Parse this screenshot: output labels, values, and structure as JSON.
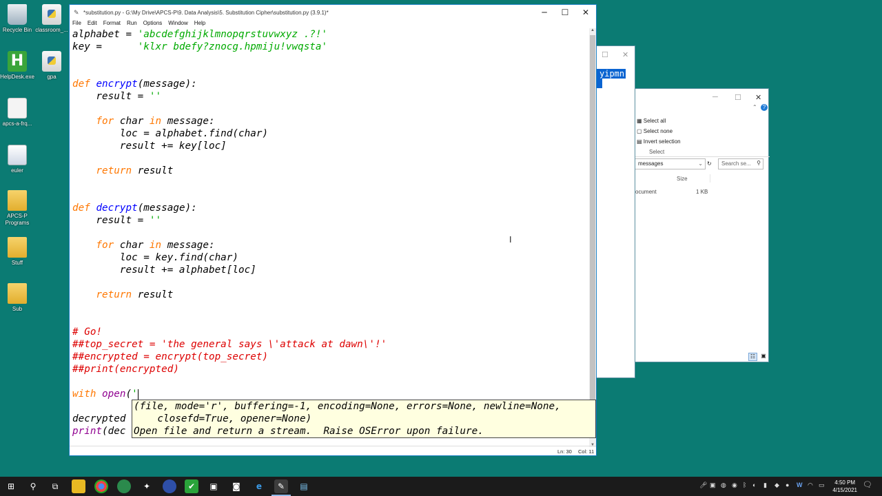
{
  "desktop": {
    "icons": [
      {
        "label": "Recycle Bin",
        "icon": "recycle-bin-icon"
      },
      {
        "label": "classroom_...",
        "icon": "python-file-icon"
      },
      {
        "label": "HelpDesk.exe",
        "icon": "helpdesk-icon"
      },
      {
        "label": "gpa",
        "icon": "python-file-icon"
      },
      {
        "label": "apcs-a-frq...",
        "icon": "document-icon"
      },
      {
        "label": "euler",
        "icon": "program-icon"
      },
      {
        "label": "APCS-P\nPrograms",
        "icon": "folder-icon"
      },
      {
        "label": "Stuff",
        "icon": "folder-icon"
      },
      {
        "label": "Sub",
        "icon": "folder-icon"
      }
    ]
  },
  "explorer_back": {
    "selected_text": "yipmn",
    "ribbon_items": [
      "Select all",
      "Select none",
      "Invert selection"
    ],
    "ribbon_group": "Select",
    "path_text": "messages",
    "search_placeholder": "Search se...",
    "column_size": "Size",
    "file_type": "ocument",
    "file_size": "1 KB"
  },
  "idle": {
    "title": "*substitution.py - G:\\My Drive\\APCS-P\\9. Data Analysis\\5. Substitution Cipher\\substitution.py (3.9.1)*",
    "menu": [
      "File",
      "Edit",
      "Format",
      "Run",
      "Options",
      "Window",
      "Help"
    ],
    "controls": {
      "minimize": "─",
      "maximize": "☐",
      "close": "✕"
    },
    "code": [
      [
        {
          "c": "txt",
          "t": "alphabet = "
        },
        {
          "c": "str",
          "t": "'abcdefghijklmnopqrstuvwxyz .?!'"
        }
      ],
      [
        {
          "c": "txt",
          "t": "key =      "
        },
        {
          "c": "str",
          "t": "'klxr bdefy?znocg.hpmiju!vwqsta'"
        }
      ],
      [],
      [],
      [
        {
          "c": "kw",
          "t": "def "
        },
        {
          "c": "def",
          "t": "encrypt"
        },
        {
          "c": "txt",
          "t": "(message):"
        }
      ],
      [
        {
          "c": "txt",
          "t": "    result = "
        },
        {
          "c": "str",
          "t": "''"
        }
      ],
      [],
      [
        {
          "c": "kw",
          "t": "    for "
        },
        {
          "c": "txt",
          "t": "char "
        },
        {
          "c": "kw",
          "t": "in "
        },
        {
          "c": "txt",
          "t": "message:"
        }
      ],
      [
        {
          "c": "txt",
          "t": "        loc = alphabet.find(char)"
        }
      ],
      [
        {
          "c": "txt",
          "t": "        result += key[loc]"
        }
      ],
      [],
      [
        {
          "c": "kw",
          "t": "    return "
        },
        {
          "c": "txt",
          "t": "result"
        }
      ],
      [],
      [],
      [
        {
          "c": "kw",
          "t": "def "
        },
        {
          "c": "def",
          "t": "decrypt"
        },
        {
          "c": "txt",
          "t": "(message):"
        }
      ],
      [
        {
          "c": "txt",
          "t": "    result = "
        },
        {
          "c": "str",
          "t": "''"
        }
      ],
      [],
      [
        {
          "c": "kw",
          "t": "    for "
        },
        {
          "c": "txt",
          "t": "char "
        },
        {
          "c": "kw",
          "t": "in "
        },
        {
          "c": "txt",
          "t": "message:"
        }
      ],
      [
        {
          "c": "txt",
          "t": "        loc = key.find(char)"
        }
      ],
      [
        {
          "c": "txt",
          "t": "        result += alphabet[loc]"
        }
      ],
      [],
      [
        {
          "c": "kw",
          "t": "    return "
        },
        {
          "c": "txt",
          "t": "result"
        }
      ],
      [],
      [],
      [
        {
          "c": "com",
          "t": "# Go!"
        }
      ],
      [
        {
          "c": "com",
          "t": "##top_secret = 'the general says \\'attack at dawn\\'!'"
        }
      ],
      [
        {
          "c": "com",
          "t": "##encrypted = encrypt(top_secret)"
        }
      ],
      [
        {
          "c": "com",
          "t": "##print(encrypted)"
        }
      ],
      [],
      [
        {
          "c": "kw",
          "t": "with "
        },
        {
          "c": "bi",
          "t": "open"
        },
        {
          "c": "txt",
          "t": "("
        },
        {
          "c": "str",
          "t": "'"
        },
        {
          "c": "caret",
          "t": ""
        }
      ],
      [],
      [
        {
          "c": "txt",
          "t": "decrypted"
        }
      ],
      [
        {
          "c": "bi",
          "t": "print"
        },
        {
          "c": "txt",
          "t": "(dec"
        }
      ]
    ],
    "calltip": "(file, mode='r', buffering=-1, encoding=None, errors=None, newline=None,\n    closefd=True, opener=None)\nOpen file and return a stream.  Raise OSError upon failure.",
    "status": {
      "line": "Ln: 30",
      "col": "Col: 11"
    }
  },
  "taskbar": {
    "clock_time": "4:50 PM",
    "clock_date": "4/15/2021",
    "apps": [
      "start-icon",
      "search-icon",
      "task-view-icon",
      "file-explorer-icon",
      "chrome-icon",
      "app-icon",
      "app-icon",
      "app-icon",
      "checkmark-app-icon",
      "camera-icon",
      "camera-icon",
      "edge-icon",
      "idle-icon",
      "notepad-icon"
    ]
  }
}
